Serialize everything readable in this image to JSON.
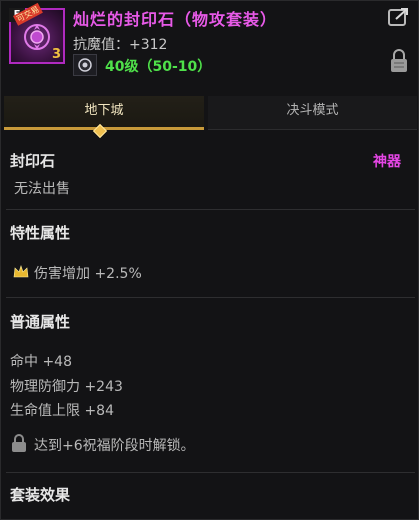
{
  "item": {
    "name": "灿烂的封印石（物攻套装）",
    "grade_badge": "E",
    "tag": "可交易",
    "stack": "3",
    "resist": "抗魔值：+312",
    "level": "40级（50-10）"
  },
  "tabs": [
    {
      "label": "地下城",
      "active": true
    },
    {
      "label": "决斗模式",
      "active": false
    }
  ],
  "category": {
    "name": "封印石",
    "type": "神器",
    "trade": "无法出售"
  },
  "special": {
    "title": "特性属性",
    "lines": [
      "伤害增加 +2.5%"
    ]
  },
  "normal": {
    "title": "普通属性",
    "lines": [
      "命中 +48",
      "物理防御力 +243",
      "生命值上限 +84"
    ]
  },
  "unlock_note": "达到+6祝福阶段时解锁。",
  "set": {
    "title": "套装效果"
  },
  "icons": [
    "share-icon",
    "lock-icon",
    "crown-icon",
    "lock-small-icon"
  ],
  "colors": {
    "title": "#e85ae8",
    "level": "#4fe04a",
    "accent": "#c89a3a",
    "type_tag": "#e646e6"
  }
}
